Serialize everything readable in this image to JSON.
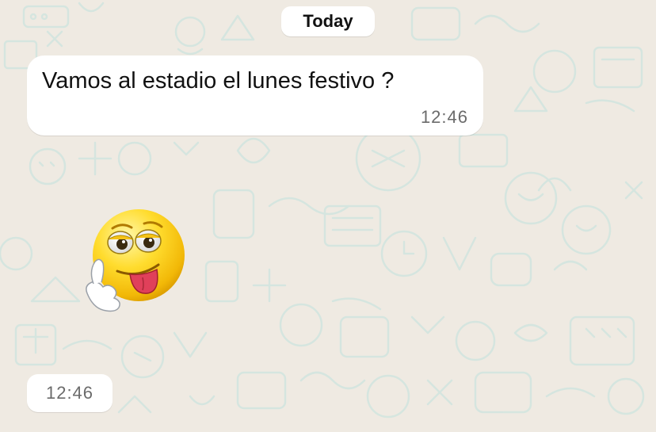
{
  "chat": {
    "date_separator": "Today",
    "messages": [
      {
        "type": "text",
        "text": "Vamos al estadio el lunes festivo ?",
        "time": "12:46"
      },
      {
        "type": "sticker",
        "sticker_icon": "silly-tongue-face-emoji-sticker",
        "time": "12:46"
      }
    ]
  },
  "colors": {
    "chat_background": "#efeae2",
    "bubble_background": "#ffffff",
    "doodle_stroke": "#d6e8e2"
  }
}
